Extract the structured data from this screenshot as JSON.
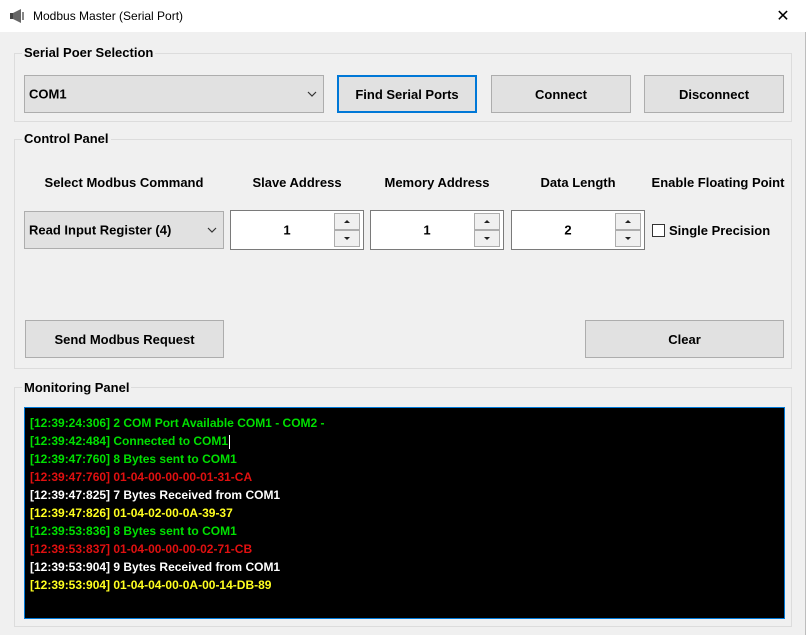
{
  "window": {
    "title": "Modbus Master (Serial Port)",
    "close_glyph": "✕"
  },
  "serial": {
    "group_title": "Serial Poer Selection",
    "port_value": "COM1",
    "find_label": "Find Serial Ports",
    "connect_label": "Connect",
    "disconnect_label": "Disconnect"
  },
  "control": {
    "group_title": "Control Panel",
    "headers": {
      "command": "Select Modbus Command",
      "slave": "Slave Address",
      "memory": "Memory Address",
      "length": "Data Length",
      "float": "Enable Floating Point"
    },
    "command_value": "Read Input Register (4)",
    "slave_value": "1",
    "memory_value": "1",
    "length_value": "2",
    "single_precision_label": "Single Precision",
    "single_precision_checked": false,
    "send_label": "Send Modbus Request",
    "clear_label": "Clear"
  },
  "monitor": {
    "group_title": "Monitoring Panel",
    "lines": [
      {
        "text": "[12:39:24:306] 2 COM Port Available COM1 - COM2 -",
        "color": "#00e000"
      },
      {
        "text": "[12:39:42:484] Connected to COM1",
        "color": "#00e000"
      },
      {
        "text": "[12:39:47:760] 8 Bytes sent to COM1",
        "color": "#00e000"
      },
      {
        "text": "[12:39:47:760] 01-04-00-00-00-01-31-CA",
        "color": "#e01010"
      },
      {
        "text": "[12:39:47:825] 7 Bytes Received from COM1",
        "color": "#ffffff"
      },
      {
        "text": "[12:39:47:826] 01-04-02-00-0A-39-37",
        "color": "#ffff20"
      },
      {
        "text": "[12:39:53:836] 8 Bytes sent to COM1",
        "color": "#00e000"
      },
      {
        "text": "[12:39:53:837] 01-04-00-00-00-02-71-CB",
        "color": "#e01010"
      },
      {
        "text": "[12:39:53:904] 9 Bytes Received from COM1",
        "color": "#ffffff"
      },
      {
        "text": "[12:39:53:904] 01-04-04-00-0A-00-14-DB-89",
        "color": "#ffff20"
      }
    ]
  }
}
